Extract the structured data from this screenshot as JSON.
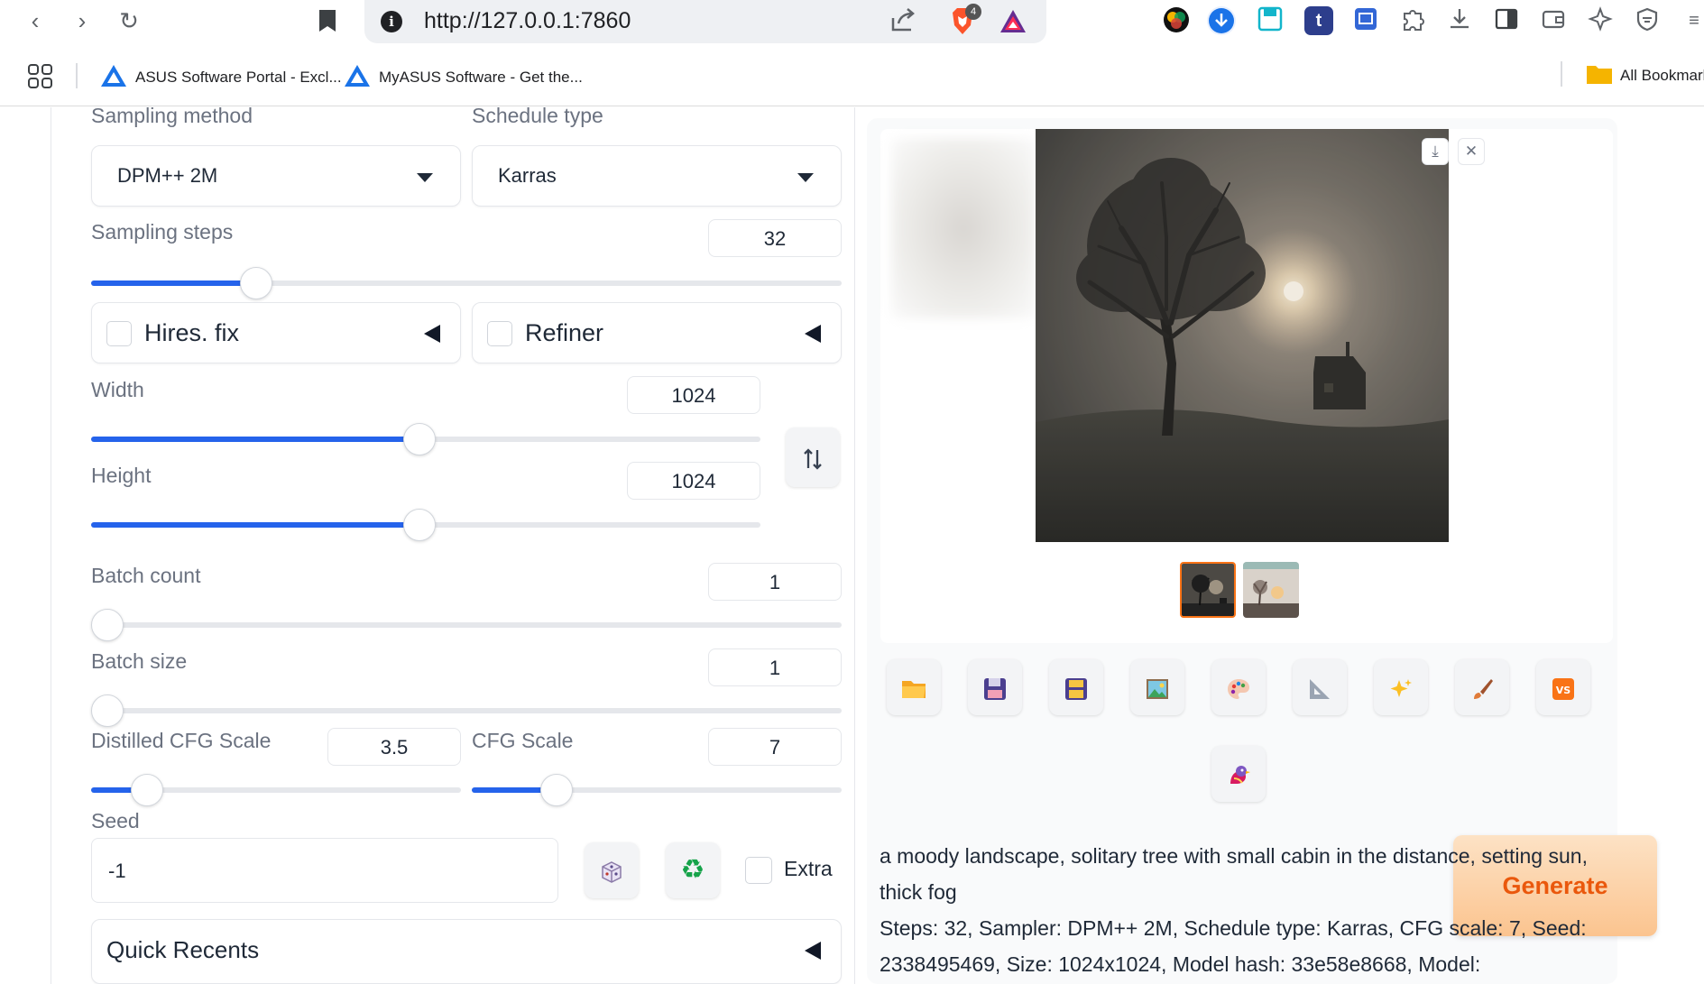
{
  "browser": {
    "url": "http://127.0.0.1:7860",
    "brave_badge": "4",
    "bookmarks": [
      {
        "label": "ASUS Software Portal - Excl..."
      },
      {
        "label": "MyASUS Software - Get the..."
      }
    ],
    "all_bookmarks": "All Bookmarks",
    "colors": {
      "tab_bar": "#eef0f3",
      "accent_blue": "#1a73e8"
    }
  },
  "settings": {
    "sampling_method": {
      "label": "Sampling method",
      "value": "DPM++ 2M"
    },
    "schedule_type": {
      "label": "Schedule type",
      "value": "Karras"
    },
    "sampling_steps": {
      "label": "Sampling steps",
      "value": "32",
      "min": 1,
      "max": 150,
      "fraction": 0.22
    },
    "hires_fix": {
      "label": "Hires. fix",
      "checked": false
    },
    "refiner": {
      "label": "Refiner",
      "checked": false
    },
    "width": {
      "label": "Width",
      "value": "1024",
      "fraction": 0.49
    },
    "height": {
      "label": "Height",
      "value": "1024",
      "fraction": 0.49
    },
    "swap_icon": "swap-vertical-icon",
    "batch_count": {
      "label": "Batch count",
      "value": "1",
      "fraction": 0
    },
    "batch_size": {
      "label": "Batch size",
      "value": "1",
      "fraction": 0
    },
    "distilled_cfg": {
      "label": "Distilled CFG Scale",
      "value": "3.5",
      "fraction": 0.15
    },
    "cfg_scale": {
      "label": "CFG Scale",
      "value": "7",
      "fraction": 0.23
    },
    "seed": {
      "label": "Seed",
      "value": "-1"
    },
    "extra": {
      "label": "Extra",
      "checked": false
    },
    "quick_recents": {
      "label": "Quick Recents"
    }
  },
  "output": {
    "tool_buttons": [
      "folder-icon",
      "save-icon",
      "zip-save-icon",
      "image-icon",
      "palette-icon",
      "ruler-icon",
      "sparkle-icon",
      "brush-icon",
      "vscode-icon",
      "bird-icon"
    ],
    "generate_label": "Generate",
    "prompt": "a moody landscape, solitary tree with small cabin in the distance, setting sun, thick fog",
    "params_line1": "Steps: 32, Sampler: DPM++ 2M, Schedule type: Karras, CFG scale: 7, Seed:",
    "params_line2": "2338495469, Size: 1024x1024, Model hash: 33e58e8668, Model:",
    "colors": {
      "generate_text": "#ea580c",
      "slider_fill": "#2563eb"
    }
  }
}
